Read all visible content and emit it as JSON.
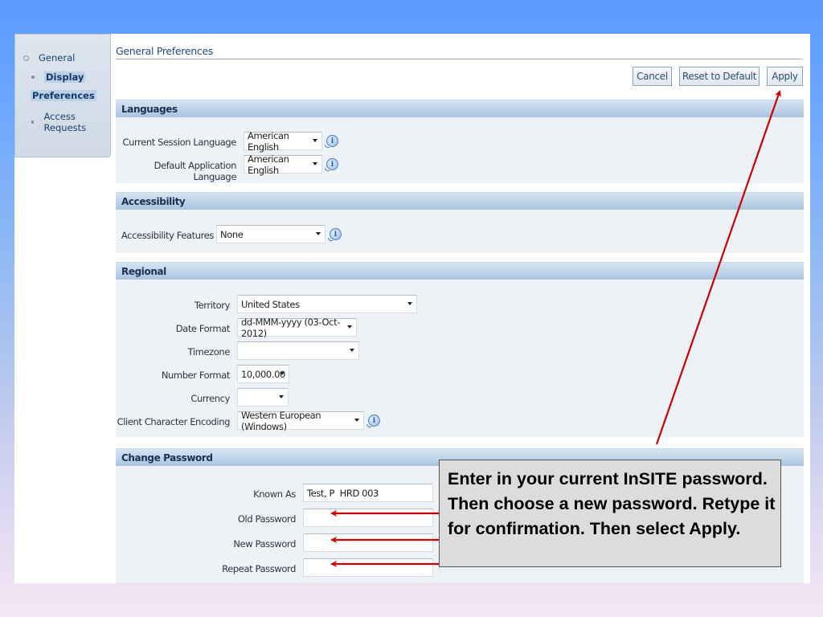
{
  "sidebar": {
    "items": [
      {
        "label": "General",
        "level": 1,
        "selected": false
      },
      {
        "label": "Display Preferences",
        "label_line1": "Display",
        "label_line2": "Preferences",
        "level": 2,
        "selected": true
      },
      {
        "label": "Access Requests",
        "level": 2,
        "selected": false
      }
    ]
  },
  "page": {
    "title": "General Preferences"
  },
  "toolbar": {
    "cancel_label": "Cancel",
    "reset_label": "Reset to Default",
    "apply_label": "Apply"
  },
  "sections": {
    "languages": {
      "title": "Languages",
      "fields": [
        {
          "label": "Current Session Language",
          "value": "American English",
          "type": "select",
          "info": true
        },
        {
          "label": "Default Application Language",
          "value": "American English",
          "type": "select",
          "info": true
        }
      ]
    },
    "accessibility": {
      "title": "Accessibility",
      "fields": [
        {
          "label": "Accessibility Features",
          "value": "None",
          "type": "select",
          "info": true
        }
      ]
    },
    "regional": {
      "title": "Regional",
      "fields": [
        {
          "label": "Territory",
          "value": "United States",
          "type": "select"
        },
        {
          "label": "Date Format",
          "value": "dd-MMM-yyyy (03-Oct-2012)",
          "type": "select"
        },
        {
          "label": "Timezone",
          "value": "",
          "type": "select"
        },
        {
          "label": "Number Format",
          "value": "10,000.00",
          "type": "select"
        },
        {
          "label": "Currency",
          "value": "",
          "type": "select"
        },
        {
          "label": "Client Character Encoding",
          "value": "Western European (Windows)",
          "type": "select",
          "info": true
        }
      ]
    },
    "change_password": {
      "title": "Change Password",
      "fields": [
        {
          "label": "Known As",
          "value": "Test, P  HRD 003",
          "type": "text"
        },
        {
          "label": "Old Password",
          "value": "",
          "type": "password"
        },
        {
          "label": "New Password",
          "value": "",
          "type": "password"
        },
        {
          "label": "Repeat Password",
          "value": "",
          "type": "password"
        }
      ]
    }
  },
  "callout": {
    "text": "Enter in your current InSITE password. Then choose a new password. Retype it for confirmation. Then select Apply."
  },
  "colors": {
    "annotation_arrow": "#cc0000",
    "section_header": "#a9c4df",
    "section_body": "#edf2f7"
  }
}
